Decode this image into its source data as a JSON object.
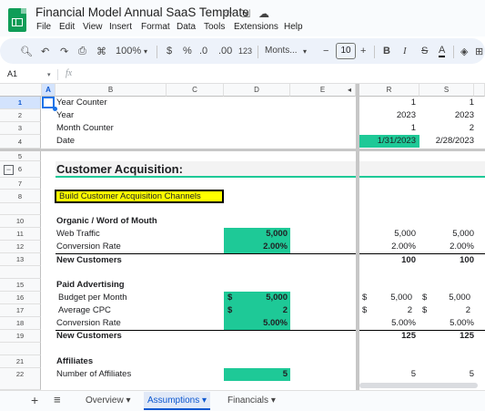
{
  "app": {
    "title": "Financial Model Annual SaaS Template",
    "menus": [
      "File",
      "Edit",
      "View",
      "Insert",
      "Format",
      "Data",
      "Tools",
      "Extensions",
      "Help"
    ]
  },
  "toolbar": {
    "zoom": "100%",
    "currency": "$",
    "percent": "%",
    "dec_decrease": ".0",
    "dec_increase": ".00",
    "number_format": "123",
    "font": "Monts...",
    "font_size": "10",
    "bold": "B",
    "italic": "I",
    "strike": "S",
    "text_color": "A"
  },
  "formula_bar": {
    "cell_ref": "A1",
    "fx": "fx"
  },
  "columns": [
    "A",
    "B",
    "C",
    "D",
    "E",
    "R",
    "S"
  ],
  "rows": [
    "1",
    "2",
    "3",
    "4",
    "5",
    "6",
    "7",
    "8",
    "10",
    "11",
    "12",
    "13",
    "15",
    "16",
    "17",
    "18",
    "19",
    "21",
    "22"
  ],
  "cells": {
    "year_counter": {
      "label": "Year Counter",
      "r": "1",
      "s": "1"
    },
    "year": {
      "label": "Year",
      "r": "2023",
      "s": "2023"
    },
    "month_counter": {
      "label": "Month Counter",
      "r": "1",
      "s": "2"
    },
    "date": {
      "label": "Date",
      "r": "1/31/2023",
      "s": "2/28/2023"
    },
    "section_title": "Customer Acquisition:",
    "build_channels": "Build Customer Acquisition Channels",
    "organic_header": "Organic / Word of Mouth",
    "web_traffic": {
      "label": "Web Traffic",
      "d": "5,000",
      "r": "5,000",
      "s": "5,000"
    },
    "conversion_rate_1": {
      "label": "Conversion Rate",
      "d": "2.00%",
      "r": "2.00%",
      "s": "2.00%"
    },
    "new_customers_1": {
      "label": "New Customers",
      "r": "100",
      "s": "100"
    },
    "paid_header": "Paid Advertising",
    "budget": {
      "label": "Budget per Month",
      "d_cur": "$",
      "d": "5,000",
      "r_cur": "$",
      "r": "5,000",
      "s_cur": "$",
      "s": "5,000"
    },
    "cpc": {
      "label": "Average CPC",
      "d_cur": "$",
      "d": "2",
      "r_cur": "$",
      "r": "2",
      "s_cur": "$",
      "s": "2"
    },
    "conversion_rate_2": {
      "label": "Conversion Rate",
      "d": "5.00%",
      "r": "5.00%",
      "s": "5.00%"
    },
    "new_customers_2": {
      "label": "New Customers",
      "r": "125",
      "s": "125"
    },
    "affiliates_header": "Affiliates",
    "num_affiliates": {
      "label": "Number of Affiliates",
      "d": "5",
      "r": "5",
      "s": "5"
    }
  },
  "sheets": [
    "Overview",
    "Assumptions",
    "Financials"
  ],
  "colors": {
    "accent_green": "#1ec997",
    "highlight_yellow": "#ffff00",
    "active_tab": "#0b57d0"
  }
}
